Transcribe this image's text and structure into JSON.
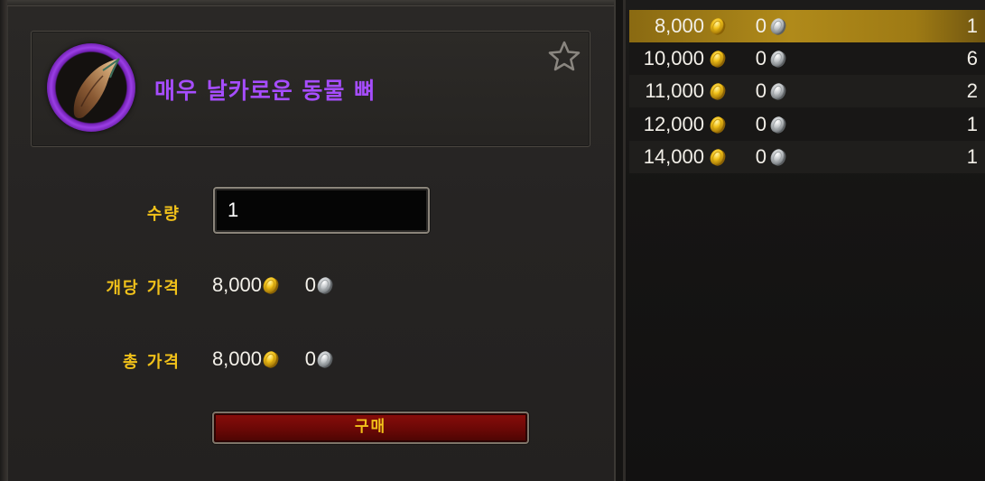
{
  "item": {
    "name": "매우 날카로운 동물 뼈",
    "icon": "animal-bone-icon",
    "rarity_color": "#a64dff"
  },
  "form": {
    "quantity_label": "수량",
    "quantity_value": "1",
    "unit_price_label": "개당 가격",
    "unit_price_gold": "8,000",
    "unit_price_silver": "0",
    "total_price_label": "총 가격",
    "total_price_gold": "8,000",
    "total_price_silver": "0",
    "buy_label": "구매"
  },
  "listings": [
    {
      "gold": "8,000",
      "silver": "0",
      "quantity": "1",
      "selected": true
    },
    {
      "gold": "10,000",
      "silver": "0",
      "quantity": "6",
      "selected": false
    },
    {
      "gold": "11,000",
      "silver": "0",
      "quantity": "2",
      "selected": false
    },
    {
      "gold": "12,000",
      "silver": "0",
      "quantity": "1",
      "selected": false
    },
    {
      "gold": "14,000",
      "silver": "0",
      "quantity": "1",
      "selected": false
    }
  ],
  "colors": {
    "label_gold": "#f2c21a",
    "button_red": "#6b0806",
    "selected_row": "#b08a1a"
  },
  "icons": {
    "gold": "gold-coin-icon",
    "silver": "silver-coin-icon",
    "favorite": "star-outline-icon"
  }
}
